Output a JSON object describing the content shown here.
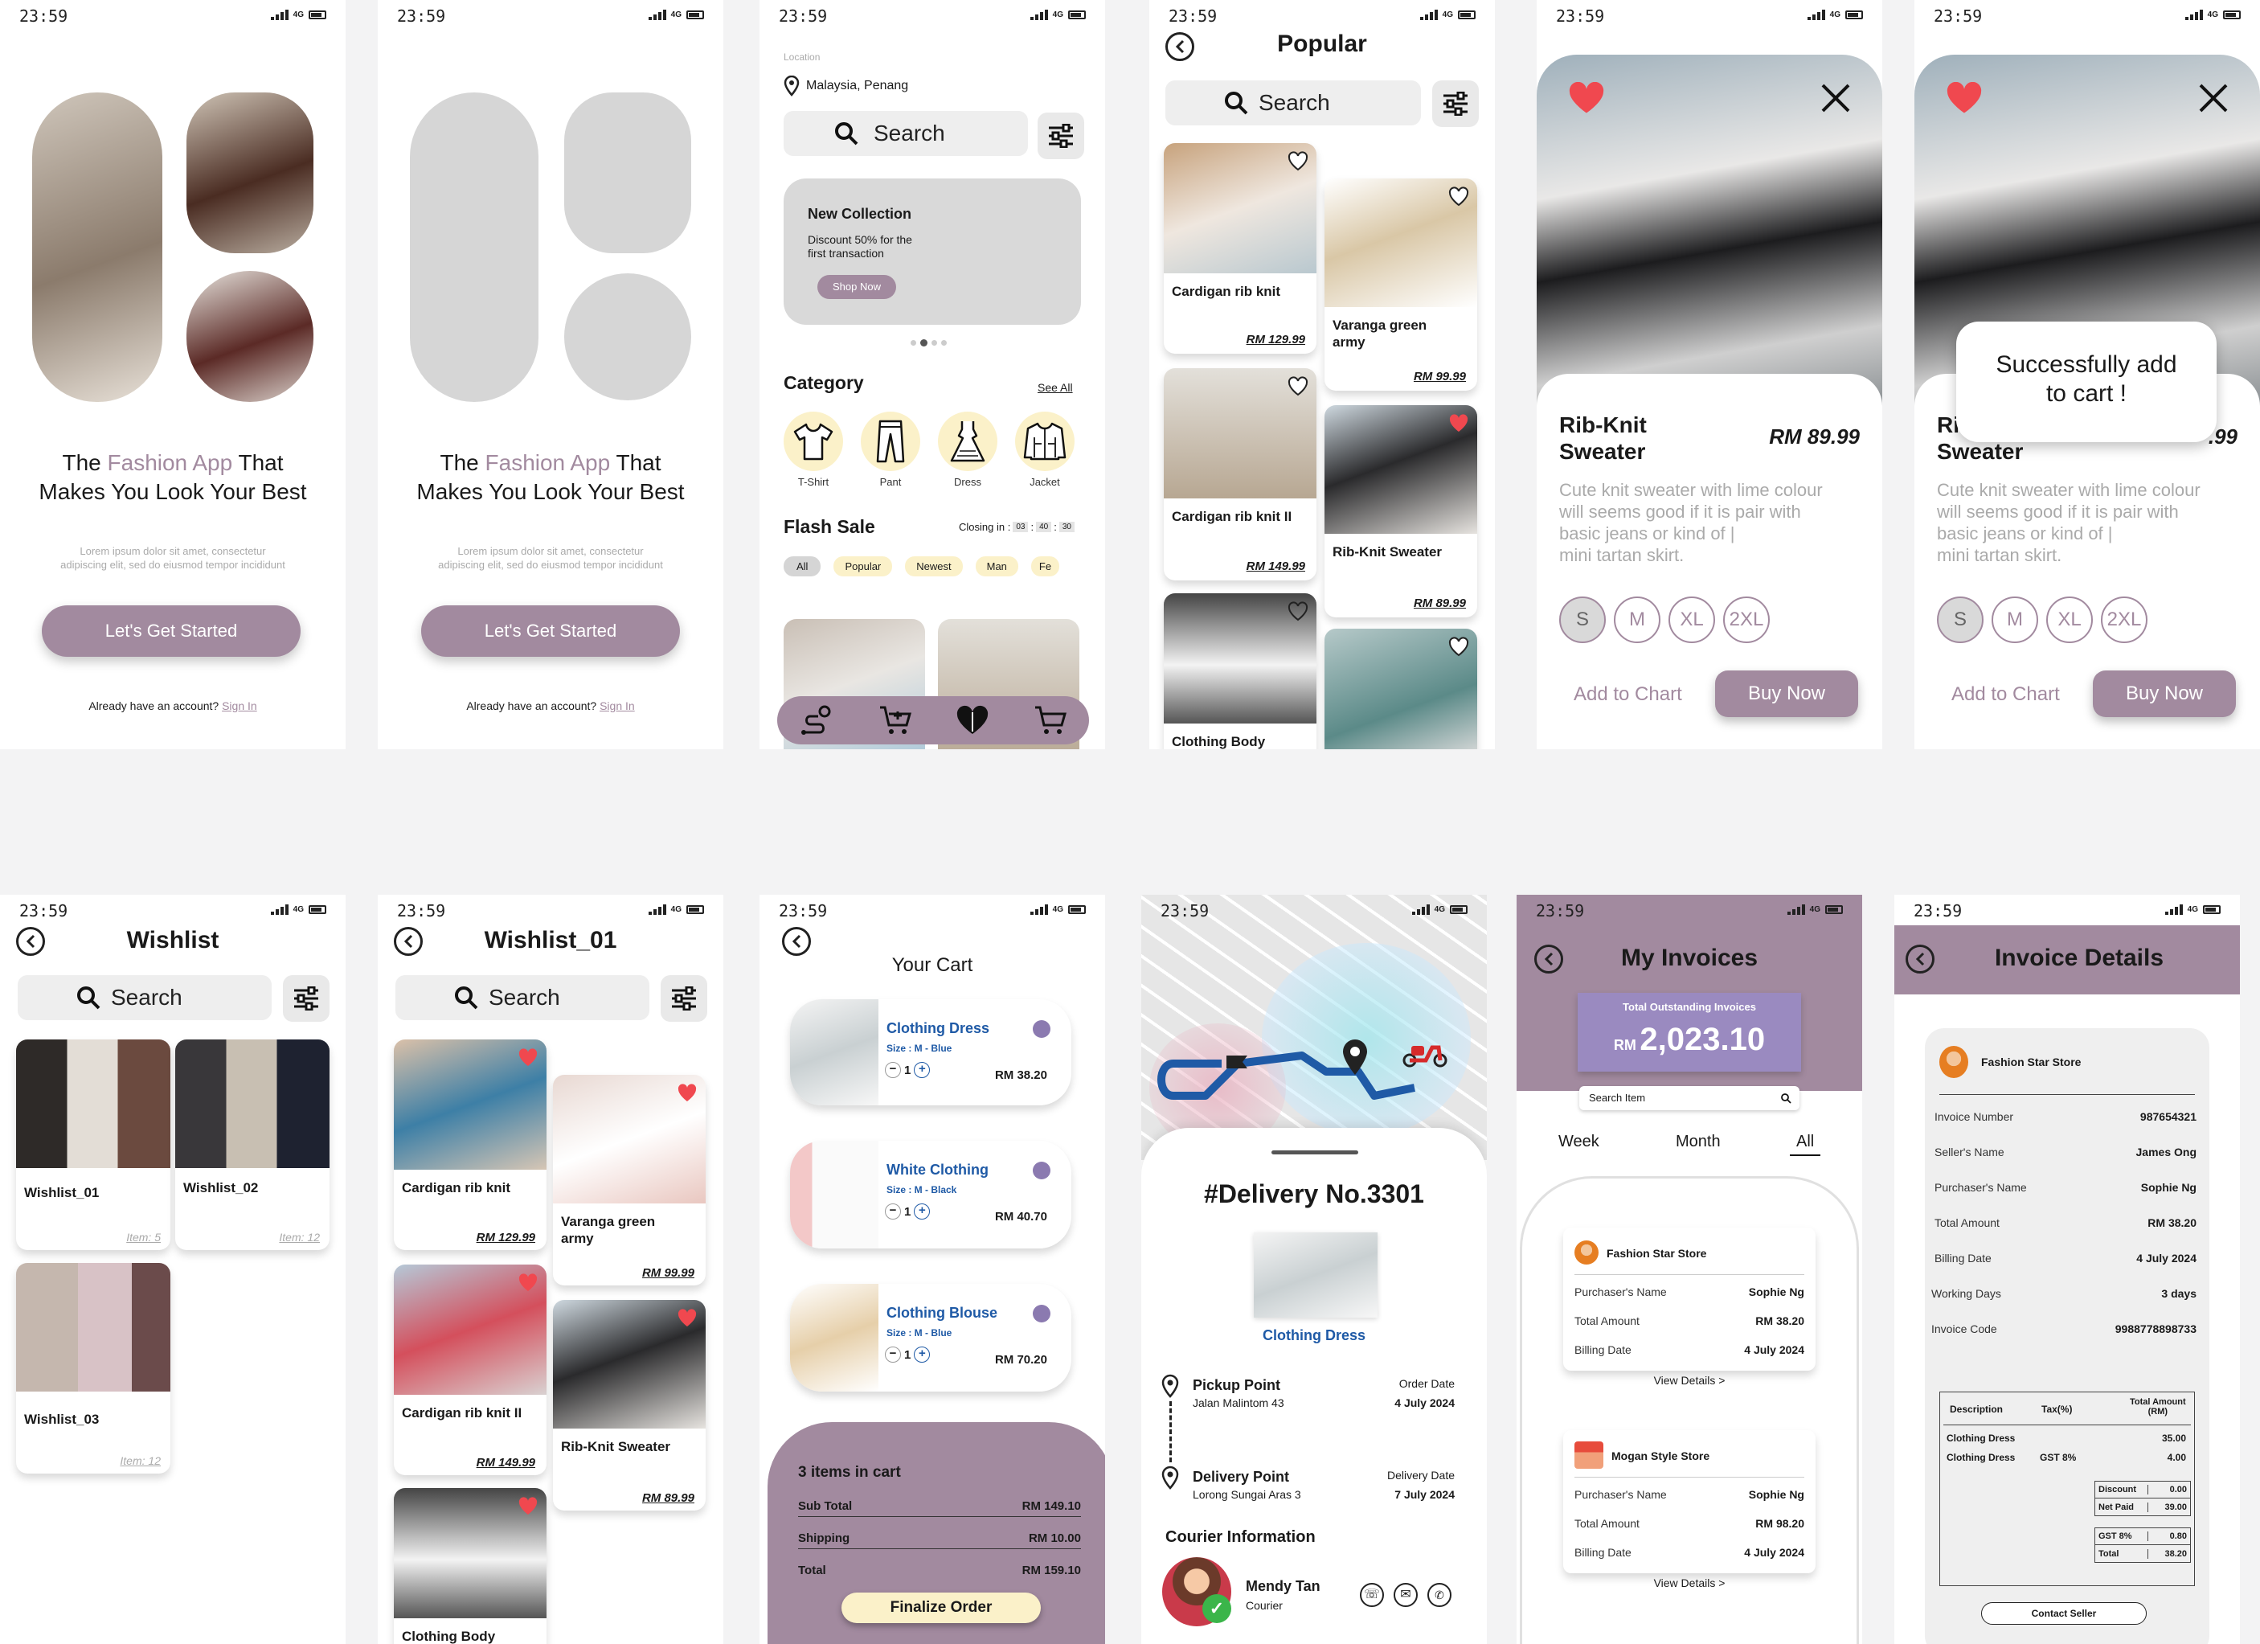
{
  "status": {
    "time": "23:59",
    "network": "4G"
  },
  "onboard": {
    "title_pre": "The ",
    "title_accent": "Fashion App",
    "title_post": " That",
    "title_line2": "Makes You Look Your Best",
    "lorem1": "Lorem ipsum dolor sit amet, consectetur",
    "lorem2": "adipiscing elit, sed do eiusmod tempor incididunt",
    "cta": "Let's Get Started",
    "signin_pre": "Already have an account? ",
    "signin": "Sign In"
  },
  "home": {
    "location_label": "Location",
    "location": "Malaysia, Penang",
    "search": "Search",
    "banner_title": "New Collection",
    "banner_sub1": "Discount 50% for the",
    "banner_sub2": "first transaction",
    "banner_btn": "Shop Now",
    "category": "Category",
    "see_all": "See All",
    "categories": [
      "T-Shirt",
      "Pant",
      "Dress",
      "Jacket"
    ],
    "flash": "Flash Sale",
    "closing": "Closing in :",
    "timer": [
      "03",
      "40",
      "30"
    ],
    "filters": [
      "All",
      "Popular",
      "Newest",
      "Man",
      "Fe"
    ]
  },
  "popular": {
    "title": "Popular",
    "search": "Search",
    "items": [
      {
        "name": "Cardigan rib knit",
        "price": "RM 129.99"
      },
      {
        "name": "Varanga green army",
        "price": "RM 99.99"
      },
      {
        "name": "Cardigan rib knit II",
        "price": "RM 149.99"
      },
      {
        "name": "Rib-Knit Sweater",
        "price": "RM 89.99"
      },
      {
        "name": "Clothing Body",
        "price": ""
      },
      {
        "name": "",
        "price": ""
      }
    ]
  },
  "detail": {
    "name1": "Rib-Knit",
    "name2": "Sweater",
    "price": "RM 89.99",
    "desc1": "Cute knit sweater with lime colour",
    "desc2": "will seems good if it is pair with",
    "desc3": "basic jeans or kind of |",
    "desc4": "mini tartan skirt.",
    "sizes": [
      "S",
      "M",
      "XL",
      "2XL"
    ],
    "add": "Add to Chart",
    "buy": "Buy Now",
    "toast1": "Successfully add",
    "toast2": "to cart !",
    "name_cut": "Ri",
    "price_cut": ".99"
  },
  "wishlist": {
    "title": "Wishlist",
    "search": "Search",
    "items": [
      {
        "name": "Wishlist_01",
        "count": "Item: 5"
      },
      {
        "name": "Wishlist_02",
        "count": "Item: 12"
      },
      {
        "name": "Wishlist_03",
        "count": "Item: 12"
      }
    ]
  },
  "wishlist01": {
    "title": "Wishlist_01",
    "search": "Search",
    "items": [
      {
        "name": "Cardigan rib knit",
        "price": "RM 129.99"
      },
      {
        "name": "Varanga green army",
        "price": "RM 99.99"
      },
      {
        "name": "Cardigan rib knit II",
        "price": "RM 149.99"
      },
      {
        "name": "Rib-Knit Sweater",
        "price": "RM 89.99"
      },
      {
        "name": "Clothing Body",
        "price": ""
      }
    ]
  },
  "cart": {
    "title": "Your Cart",
    "items": [
      {
        "name": "Clothing Dress",
        "size": "Size : M - Blue",
        "qty": "1",
        "price": "RM 38.20"
      },
      {
        "name": "White Clothing",
        "size": "Size : M - Black",
        "qty": "1",
        "price": "RM 40.70"
      },
      {
        "name": "Clothing Blouse",
        "size": "Size : M - Blue",
        "qty": "1",
        "price": "RM 70.20"
      }
    ],
    "count": "3 items in cart",
    "sub_l": "Sub Total",
    "sub_v": "RM 149.10",
    "ship_l": "Shipping",
    "ship_v": "RM 10.00",
    "tot_l": "Total",
    "tot_v": "RM 159.10",
    "btn": "Finalize Order"
  },
  "delivery": {
    "title": "#Delivery No.3301",
    "item": "Clothing Dress",
    "pickup": "Pickup Point",
    "pickup_addr": "Jalan Malintom 43",
    "order_l": "Order Date",
    "order_d": "4 July 2024",
    "dpoint": "Delivery Point",
    "dpoint_addr": "Lorong Sungai Aras 3",
    "deliv_l": "Delivery Date",
    "deliv_d": "7 July 2024",
    "courier_h": "Courier Information",
    "courier": "Mendy Tan",
    "role": "Courier"
  },
  "invoices": {
    "title": "My Invoices",
    "total_l": "Total Outstanding Invoices",
    "cur": "RM",
    "amount": "2,023.10",
    "search": "Search Item",
    "tabs": [
      "Week",
      "Month",
      "All"
    ],
    "cards": [
      {
        "store": "Fashion Star Store",
        "p_l": "Purchaser's Name",
        "p_v": "Sophie Ng",
        "t_l": "Total Amount",
        "t_v": "RM 38.20",
        "b_l": "Billing Date",
        "b_v": "4 July 2024",
        "view": "View Details  >"
      },
      {
        "store": "Mogan Style Store",
        "p_l": "Purchaser's Name",
        "p_v": "Sophie Ng",
        "t_l": "Total Amount",
        "t_v": "RM 98.20",
        "b_l": "Billing Date",
        "b_v": "4 July 2024",
        "view": "View Details  >"
      }
    ]
  },
  "invoice": {
    "title": "Invoice Details",
    "store": "Fashion Star Store",
    "rows": [
      {
        "l": "Invoice Number",
        "v": "987654321"
      },
      {
        "l": "Seller's Name",
        "v": "James Ong"
      },
      {
        "l": "Purchaser's Name",
        "v": "Sophie Ng"
      },
      {
        "l": "Total Amount",
        "v": "RM 38.20"
      },
      {
        "l": "Billing Date",
        "v": "4 July 2024"
      },
      {
        "l": "Working Days",
        "v": "3 days"
      },
      {
        "l": "Invoice Code",
        "v": "9988778898733"
      }
    ],
    "th": [
      "Description",
      "Tax(%)",
      "Total Amount",
      "(RM)"
    ],
    "lines": [
      {
        "d": "Clothing Dress",
        "t": "",
        "a": "35.00"
      },
      {
        "d": "Clothing Dress",
        "t": "GST 8%",
        "a": "4.00"
      }
    ],
    "sum": [
      {
        "l": "Discount",
        "v": "0.00"
      },
      {
        "l": "Net Paid",
        "v": "39.00"
      },
      {
        "l": "GST 8%",
        "v": "0.80"
      },
      {
        "l": "Total",
        "v": "38.20"
      }
    ],
    "contact": "Contact Seller"
  },
  "colors": {
    "accent": "#a28a9f",
    "heart": "#f0484f",
    "blue": "#1f5aa6",
    "panel": "#a28a9f"
  }
}
